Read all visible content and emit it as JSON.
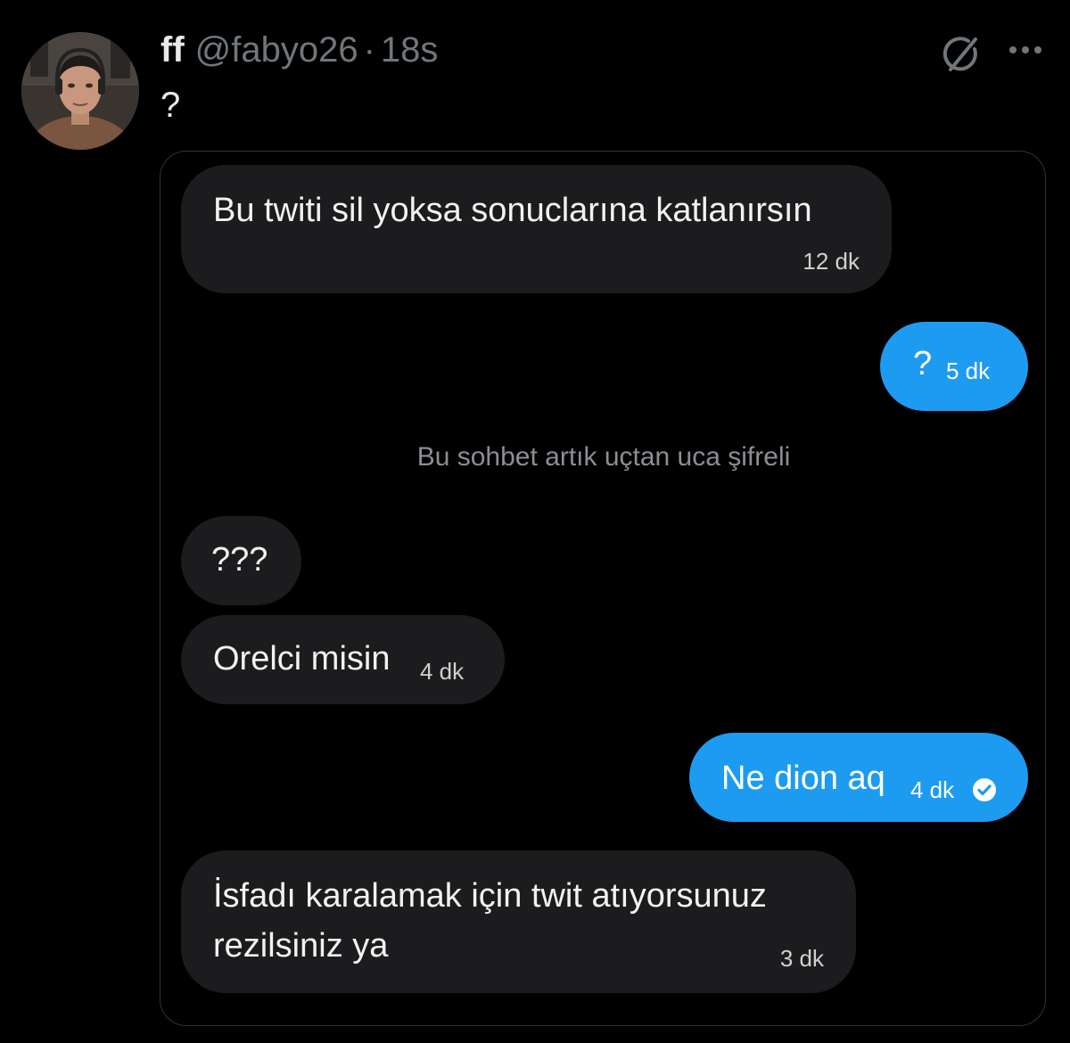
{
  "tweet": {
    "display_name": "ff",
    "handle": "@fabyo26",
    "separator": "·",
    "time": "18s",
    "text": "?"
  },
  "icons": {
    "avatar": "profile-photo",
    "grok": "grok-icon",
    "more": "more-dots-icon",
    "read_receipt": "check-circle-icon"
  },
  "colors": {
    "background": "#000000",
    "incoming_bubble": "#1c1c1e",
    "outgoing_bubble": "#1d9bf0",
    "muted_text": "#71767b"
  },
  "chat": {
    "messages": [
      {
        "text": "Bu twiti sil yoksa sonuclarına katlanırsın",
        "time": "12 dk"
      },
      {
        "text": "?",
        "time": "5 dk"
      },
      {
        "text": "???"
      },
      {
        "text": "Orelci misin",
        "time": "4 dk"
      },
      {
        "text": "Ne dion aq",
        "time": "4 dk"
      },
      {
        "text_line1": "İsfadı karalamak için twit atıyorsunuz",
        "text_line2": "rezilsiniz ya",
        "time": "3 dk"
      }
    ],
    "system_notice": "Bu sohbet artık uçtan uca şifreli"
  }
}
